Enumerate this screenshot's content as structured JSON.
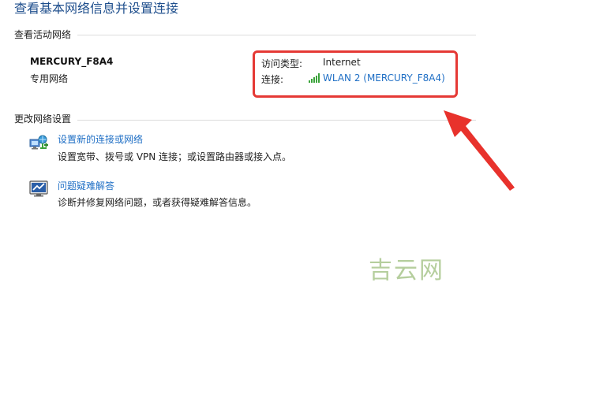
{
  "page_title": "查看基本网络信息并设置连接",
  "active_networks": {
    "header": "查看活动网络",
    "network_name": "MERCURY_F8A4",
    "network_type": "专用网络",
    "access_type_label": "访问类型:",
    "access_type_value": "Internet",
    "connection_label": "连接:",
    "connection_link": "WLAN 2 (MERCURY_F8A4)"
  },
  "change_settings": {
    "header": "更改网络设置",
    "tasks": [
      {
        "link": "设置新的连接或网络",
        "description": "设置宽带、拨号或 VPN 连接；或设置路由器或接入点。",
        "icon": "new-connection-icon"
      },
      {
        "link": "问题疑难解答",
        "description": "诊断并修复网络问题，或者获得疑难解答信息。",
        "icon": "troubleshoot-icon"
      }
    ]
  },
  "watermark": "吉云网",
  "colors": {
    "link": "#1f6fc5",
    "title": "#1e4e8c",
    "highlight": "#e53935",
    "signal": "#3aa33a",
    "watermark": "#8fb56a"
  }
}
